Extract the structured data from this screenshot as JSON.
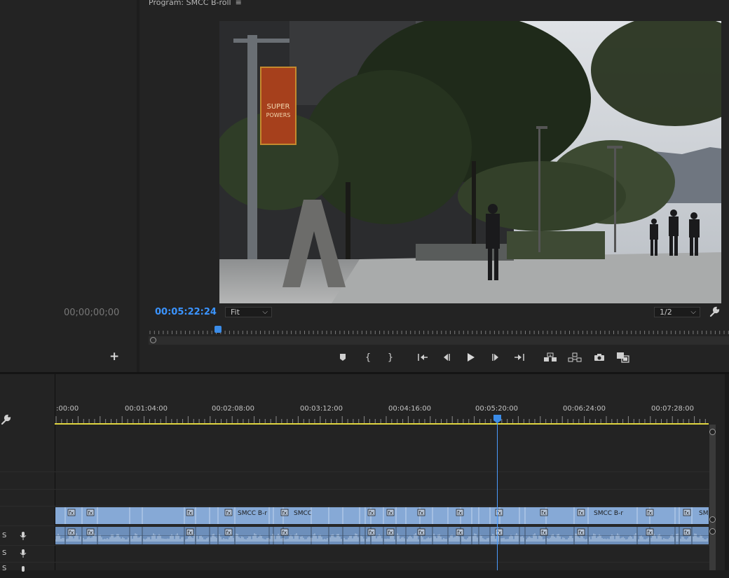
{
  "program_monitor": {
    "title": "Program: SMCC B-roll",
    "menu_icon": "hamburger-menu-icon",
    "timecode": "00:05:22:24",
    "zoom_select": "Fit",
    "resolution_select": "1/2",
    "video_banner": [
      "SUPER",
      "POWERS"
    ],
    "transport_icons": [
      "marker-icon",
      "mark-in-icon",
      "mark-out-icon",
      "go-to-in-icon",
      "step-back-icon",
      "play-icon",
      "step-forward-icon",
      "go-to-out-icon",
      "lift-icon",
      "extract-icon",
      "camera-icon",
      "compare-icon"
    ]
  },
  "source_panel": {
    "timecode": "00;00;00;00",
    "add_label": "+"
  },
  "timeline": {
    "ruler_labels": [
      ":00:00",
      "00:01:04:00",
      "00:02:08:00",
      "00:03:12:00",
      "00:04:16:00",
      "00:05:20:00",
      "00:06:24:00",
      "00:07:28:00"
    ],
    "clip_labels": [
      "SMCC B-r",
      "SMCC",
      "SMCC B-r",
      "SM"
    ],
    "fx_label": "fx",
    "track_letters": [
      "S",
      "S",
      "S"
    ],
    "accent": "#3b94ff",
    "clip_color": "#86a9d6"
  }
}
